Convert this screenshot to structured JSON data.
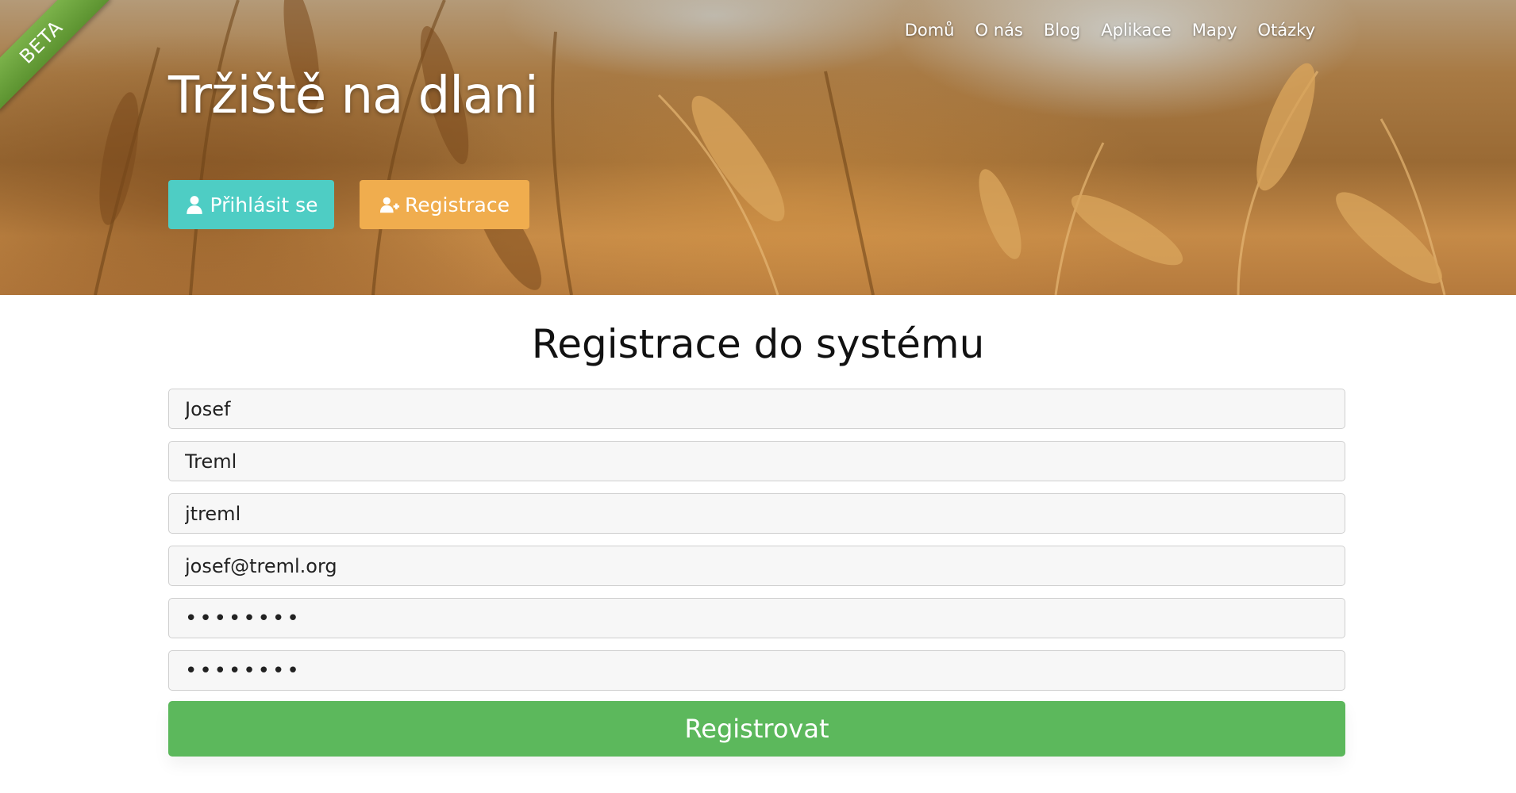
{
  "ribbon": {
    "label": "BETA"
  },
  "nav": {
    "items": [
      "Domů",
      "O nás",
      "Blog",
      "Aplikace",
      "Mapy",
      "Otázky"
    ]
  },
  "header": {
    "title": "Tržiště na dlani"
  },
  "buttons": {
    "login_label": "Přihlásit se",
    "register_label": "Registrace"
  },
  "form": {
    "title": "Registrace do systému",
    "first_name": "Josef",
    "last_name": "Treml",
    "username": "jtreml",
    "email": "josef@treml.org",
    "password": "••••••••",
    "password_confirm": "••••••••",
    "submit_label": "Registrovat"
  },
  "colors": {
    "login_button": "#4ecdc4",
    "register_button": "#f0ad4e",
    "submit_button": "#5cb85c",
    "ribbon": "#6ca23c"
  },
  "icons": {
    "login": "user-icon",
    "register": "user-plus-icon"
  }
}
